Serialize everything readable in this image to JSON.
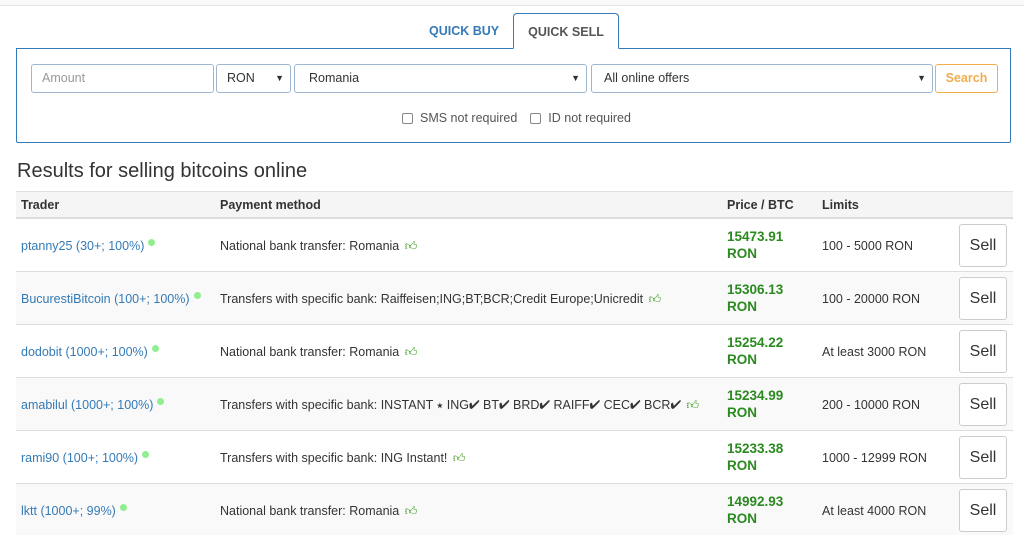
{
  "tabs": {
    "buy": "QUICK BUY",
    "sell": "QUICK SELL"
  },
  "form": {
    "amount_placeholder": "Amount",
    "currency": "RON",
    "country": "Romania",
    "offers": "All online offers",
    "search_label": "Search",
    "sms_label": "SMS not required",
    "id_label": "ID not required"
  },
  "results": {
    "title": "Results for selling bitcoins online",
    "headers": {
      "trader": "Trader",
      "payment": "Payment method",
      "price": "Price / BTC",
      "limits": "Limits"
    },
    "rows": [
      {
        "trader": "ptanny25 (30+; 100%)",
        "payment": "National bank transfer: Romania",
        "price": "15473.91",
        "currency": "RON",
        "limits": "100 - 5000 RON",
        "action": "Sell"
      },
      {
        "trader": "BucurestiBitcoin (100+; 100%)",
        "payment": "Transfers with specific bank: Raiffeisen;ING;BT;BCR;Credit Europe;Unicredit",
        "price": "15306.13",
        "currency": "RON",
        "limits": "100 - 20000 RON",
        "action": "Sell"
      },
      {
        "trader": "dodobit (1000+; 100%)",
        "payment": "National bank transfer: Romania",
        "price": "15254.22",
        "currency": "RON",
        "limits": "At least 3000 RON",
        "action": "Sell"
      },
      {
        "trader": "amabilul (1000+; 100%)",
        "payment": "Transfers with specific bank: INSTANT ⭑ ING✔ BT✔ BRD✔ RAIFF✔ CEC✔ BCR✔",
        "price": "15234.99",
        "currency": "RON",
        "limits": "200 - 10000 RON",
        "action": "Sell"
      },
      {
        "trader": "rami90 (100+; 100%)",
        "payment": "Transfers with specific bank: ING Instant!",
        "price": "15233.38",
        "currency": "RON",
        "limits": "1000 - 12999 RON",
        "action": "Sell"
      },
      {
        "trader": "lktt (1000+; 99%)",
        "payment": "National bank transfer: Romania",
        "price": "14992.93",
        "currency": "RON",
        "limits": "At least 4000 RON",
        "action": "Sell"
      }
    ]
  },
  "icons": {
    "thumb": "thumbs-up-icon",
    "online": "online-dot-icon",
    "caret": "caret-down-icon"
  },
  "colors": {
    "link": "#337ab7",
    "price": "#2b8a1f",
    "search": "#f0ad4e",
    "online": "#90ee90"
  }
}
